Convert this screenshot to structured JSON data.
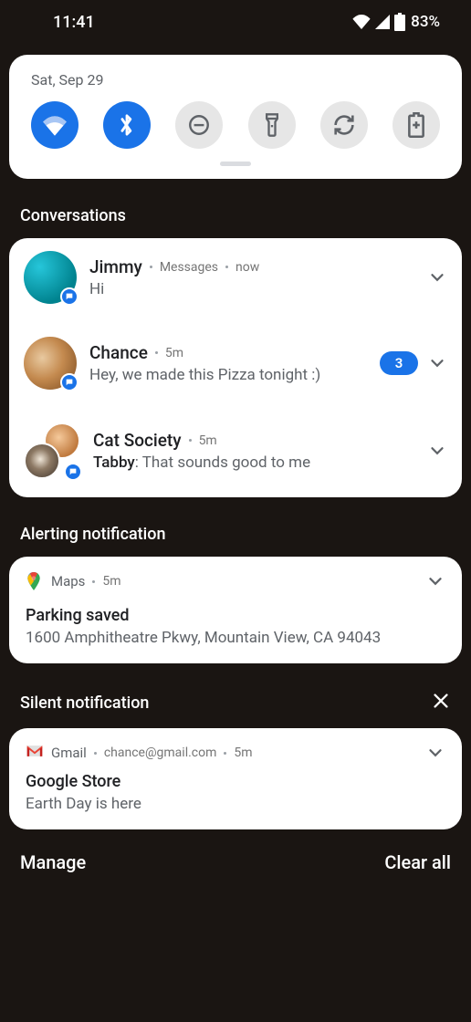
{
  "status": {
    "time": "11:41",
    "battery_pct": "83%"
  },
  "qs": {
    "date": "Sat, Sep 29"
  },
  "sections": {
    "conversations": "Conversations",
    "alerting": "Alerting notification",
    "silent": "Silent notification"
  },
  "conversations": [
    {
      "title": "Jimmy",
      "app": "Messages",
      "time": "now",
      "text": "Hi"
    },
    {
      "title": "Chance",
      "time": "5m",
      "text": "Hey, we made this Pizza tonight :)",
      "count": "3"
    },
    {
      "title": "Cat Society",
      "time": "5m",
      "sender": "Tabby",
      "text": "That sounds good to me"
    }
  ],
  "maps": {
    "app": "Maps",
    "time": "5m",
    "title": "Parking saved",
    "body": "1600 Amphitheatre Pkwy, Mountain View, CA 94043"
  },
  "gmail": {
    "app": "Gmail",
    "account": "chance@gmail.com",
    "time": "5m",
    "title": "Google Store",
    "body": "Earth Day is here"
  },
  "bottom": {
    "manage": "Manage",
    "clear_all": "Clear all"
  }
}
